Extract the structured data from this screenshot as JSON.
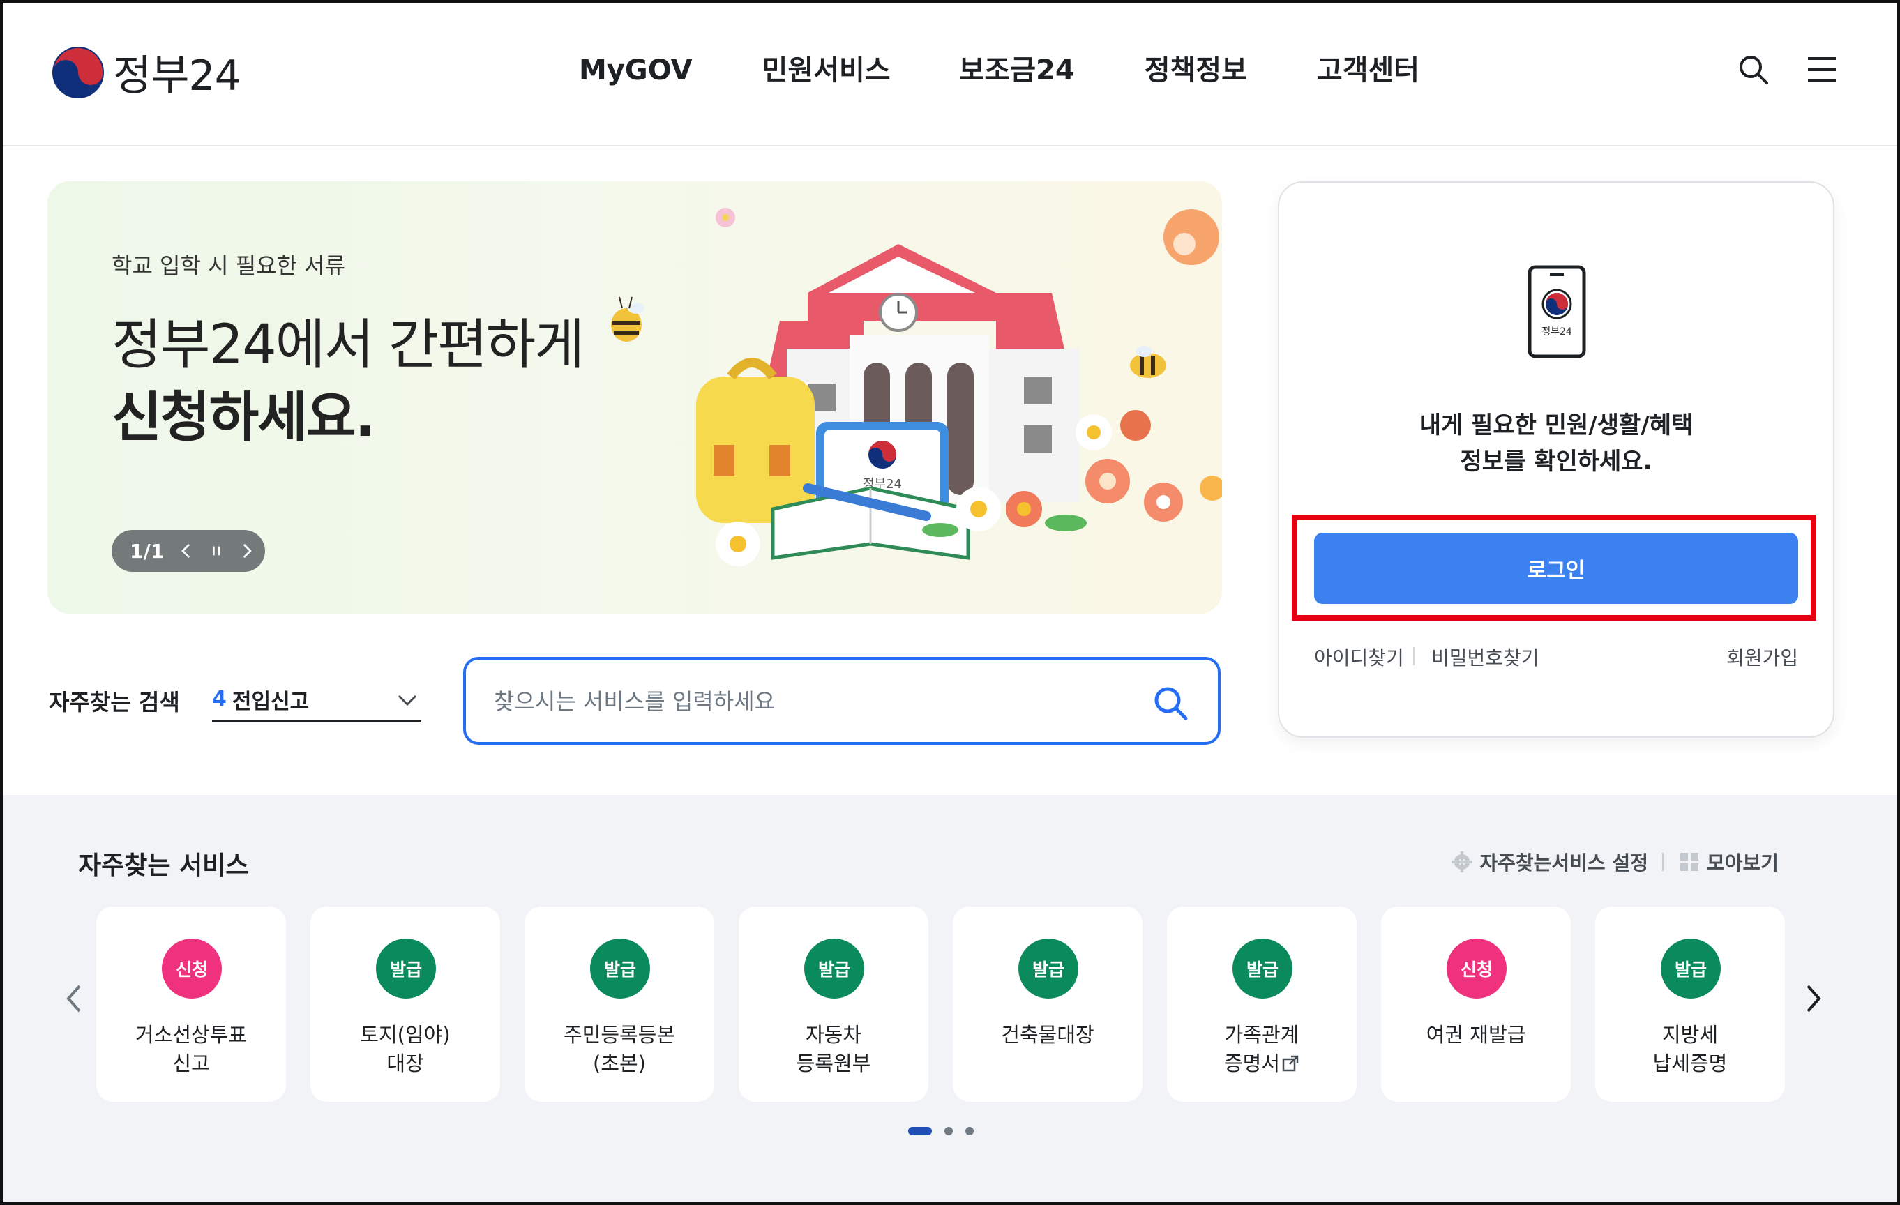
{
  "header": {
    "logo_text": "정부24",
    "nav": [
      "MyGOV",
      "민원서비스",
      "보조금24",
      "정책정보",
      "고객센터"
    ],
    "search_icon": "search-icon",
    "menu_icon": "hamburger-menu-icon"
  },
  "banner": {
    "subtitle": "학교 입학 시 필요한 서류",
    "title_line1": "정부24에서 간편하게",
    "title_line2": "신청하세요.",
    "slide_counter": "1/1",
    "book_label": "정부24"
  },
  "search": {
    "fav_label": "자주찾는 검색",
    "fav_rank": "4",
    "fav_value": "전입신고",
    "placeholder": "찾으시는 서비스를 입력하세요"
  },
  "login": {
    "phone_label": "정부24",
    "message_line1": "내게 필요한 민원/생활/혜택",
    "message_line2": "정보를 확인하세요.",
    "button": "로그인",
    "find_id": "아이디찾기",
    "find_pw": "비밀번호찾기",
    "join": "회원가입"
  },
  "services": {
    "title": "자주찾는 서비스",
    "settings": "자주찾는서비스 설정",
    "view_all": "모아보기",
    "items": [
      {
        "badge": "신청",
        "line1": "거소선상투표",
        "line2": "신고"
      },
      {
        "badge": "발급",
        "line1": "토지(임야)",
        "line2": "대장"
      },
      {
        "badge": "발급",
        "line1": "주민등록등본",
        "line2": "(초본)"
      },
      {
        "badge": "발급",
        "line1": "자동차",
        "line2": "등록원부"
      },
      {
        "badge": "발급",
        "line1": "건축물대장",
        "line2": ""
      },
      {
        "badge": "발급",
        "line1": "가족관계",
        "line2": "증명서"
      },
      {
        "badge": "신청",
        "line1": "여권 재발급",
        "line2": ""
      },
      {
        "badge": "발급",
        "line1": "지방세",
        "line2": "납세증명"
      }
    ]
  },
  "colors": {
    "primary": "#256ef4",
    "login_button": "#3b82f0",
    "highlight": "#e60012",
    "apply_badge": "#f0317e",
    "issue_badge": "#0b8a5c"
  }
}
